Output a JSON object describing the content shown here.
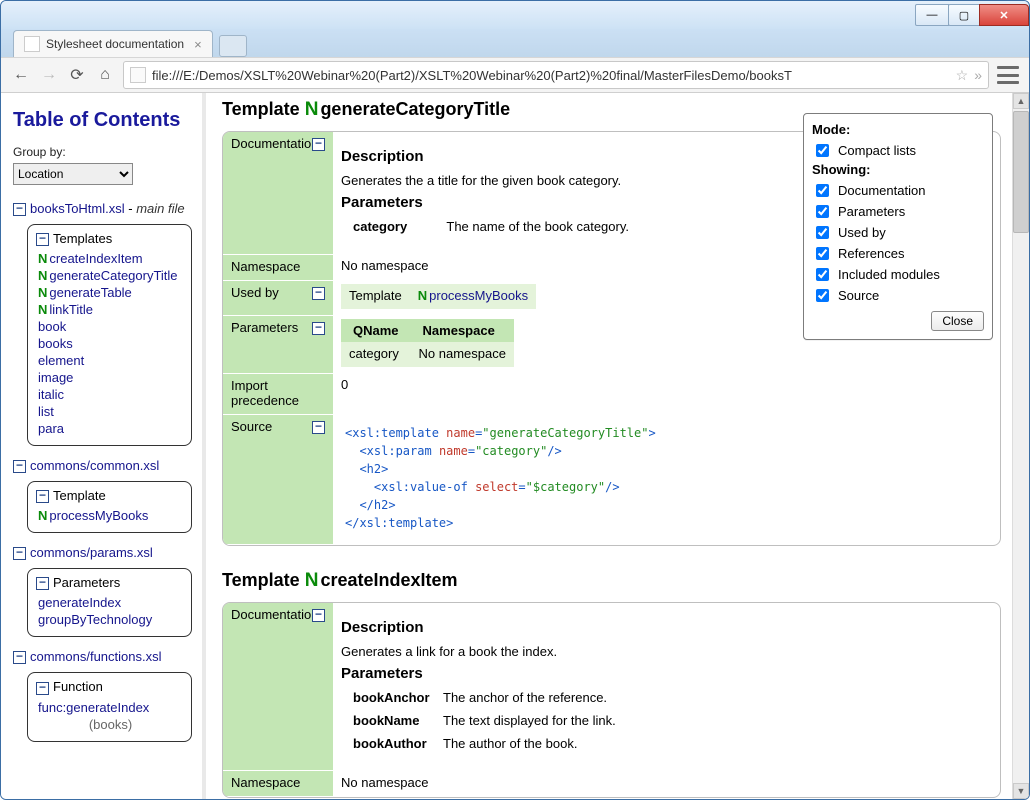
{
  "window": {
    "tab_title": "Stylesheet documentation",
    "url": "file:///E:/Demos/XSLT%20Webinar%20(Part2)/XSLT%20Webinar%20(Part2)%20final/MasterFilesDemo/booksT"
  },
  "sidebar": {
    "title": "Table of Contents",
    "group_by_label": "Group by:",
    "group_by_value": "Location",
    "main_file": {
      "name": "booksToHtml.xsl",
      "suffix": "main file"
    },
    "templates_header": "Templates",
    "templates_named": [
      "createIndexItem",
      "generateCategoryTitle",
      "generateTable",
      "linkTitle"
    ],
    "templates_match": [
      "book",
      "books",
      "element",
      "image",
      "italic",
      "list",
      "para"
    ],
    "commons_common": "commons/common.xsl",
    "template_header": "Template",
    "template_items": [
      "processMyBooks"
    ],
    "commons_params": "commons/params.xsl",
    "params_header": "Parameters",
    "params_items": [
      "generateIndex",
      "groupByTechnology"
    ],
    "commons_functions": "commons/functions.xsl",
    "function_header": "Function",
    "function_items": [
      "func:generateIndex"
    ],
    "function_tail": "(books)"
  },
  "content": {
    "t1": {
      "title_prefix": "Template",
      "title_name": "generateCategoryTitle",
      "rows": {
        "documentation": "Documentation",
        "namespace": "Namespace",
        "namespace_val": "No namespace",
        "used_by": "Used by",
        "parameters": "Parameters",
        "import": "Import precedence",
        "import_val": "0",
        "source": "Source"
      },
      "desc_h": "Description",
      "desc": "Generates the a title for the given book category.",
      "params_h": "Parameters",
      "params": [
        {
          "name": "category",
          "desc": "The name of the book category."
        }
      ],
      "used_by_row": {
        "kind": "Template",
        "name": "processMyBooks"
      },
      "param_table": {
        "h1": "QName",
        "h2": "Namespace",
        "r1": "category",
        "r2": "No namespace"
      },
      "source_lines": [
        {
          "seg": [
            {
              "c": "t-blue",
              "t": "<xsl:template "
            },
            {
              "c": "t-red",
              "t": "name"
            },
            {
              "c": "t-blue",
              "t": "="
            },
            {
              "c": "t-green",
              "t": "\"generateCategoryTitle\""
            },
            {
              "c": "t-blue",
              "t": ">"
            }
          ]
        },
        {
          "indent": 1,
          "seg": [
            {
              "c": "t-blue",
              "t": "<xsl:param "
            },
            {
              "c": "t-red",
              "t": "name"
            },
            {
              "c": "t-blue",
              "t": "="
            },
            {
              "c": "t-green",
              "t": "\"category\""
            },
            {
              "c": "t-blue",
              "t": "/>"
            }
          ]
        },
        {
          "indent": 1,
          "seg": [
            {
              "c": "t-blue",
              "t": "<h2>"
            }
          ]
        },
        {
          "indent": 2,
          "seg": [
            {
              "c": "t-blue",
              "t": "<xsl:value-of "
            },
            {
              "c": "t-red",
              "t": "select"
            },
            {
              "c": "t-blue",
              "t": "="
            },
            {
              "c": "t-green",
              "t": "\"$category\""
            },
            {
              "c": "t-blue",
              "t": "/>"
            }
          ]
        },
        {
          "indent": 1,
          "seg": [
            {
              "c": "t-blue",
              "t": "</h2>"
            }
          ]
        },
        {
          "seg": [
            {
              "c": "t-blue",
              "t": "</xsl:template>"
            }
          ]
        }
      ]
    },
    "t2": {
      "title_prefix": "Template",
      "title_name": "createIndexItem",
      "rows": {
        "documentation": "Documentation",
        "namespace": "Namespace",
        "namespace_val": "No namespace"
      },
      "desc_h": "Description",
      "desc": "Generates a link for a book the index.",
      "params_h": "Parameters",
      "params": [
        {
          "name": "bookAnchor",
          "desc": "The anchor of the reference."
        },
        {
          "name": "bookName",
          "desc": "The text displayed for the link."
        },
        {
          "name": "bookAuthor",
          "desc": "The author of the book."
        }
      ]
    }
  },
  "options": {
    "mode": "Mode:",
    "compact": "Compact lists",
    "showing": "Showing:",
    "items": [
      "Documentation",
      "Parameters",
      "Used by",
      "References",
      "Included modules",
      "Source"
    ],
    "close": "Close"
  }
}
